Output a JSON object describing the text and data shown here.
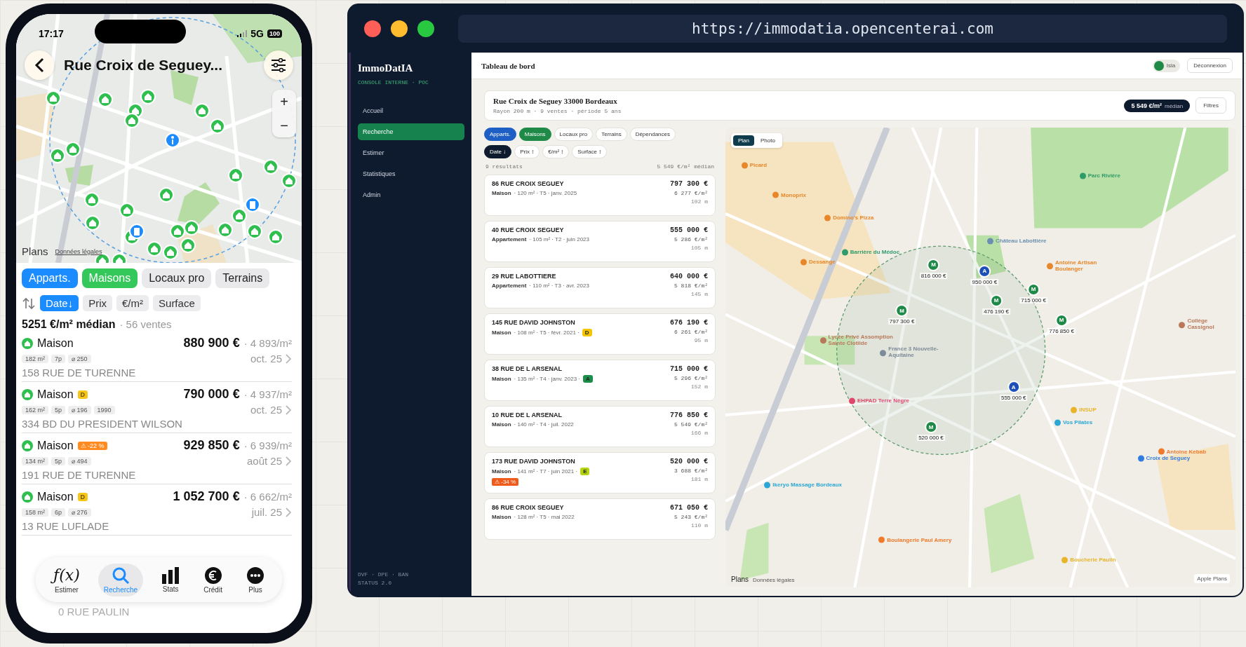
{
  "phone": {
    "status": {
      "time": "17:17",
      "network": "5G",
      "battery": "100"
    },
    "title": "Rue Croix de Seguey...",
    "map": {
      "attribution": "Plans",
      "legal": "Données légales",
      "zoom_in": "+",
      "zoom_out": "−"
    },
    "types": [
      {
        "label": "Apparts.",
        "selected": true,
        "color": "#1a8cff"
      },
      {
        "label": "Maisons",
        "selected": true,
        "color": "#34c759"
      },
      {
        "label": "Locaux pro",
        "selected": false
      },
      {
        "label": "Terrains",
        "selected": false
      }
    ],
    "sorts": [
      {
        "label": "Date↓",
        "selected": true
      },
      {
        "label": "Prix",
        "selected": false
      },
      {
        "label": "€/m²",
        "selected": false
      },
      {
        "label": "Surface",
        "selected": false
      }
    ],
    "median": "5251 €/m² médian",
    "count": "· 56 ventes",
    "listings": [
      {
        "type": "Maison",
        "price": "880 900 €",
        "ppm": "· 4 893/m²",
        "chips": [
          "182 m²",
          "7p",
          "⌀ 250"
        ],
        "date": "oct. 25",
        "address": "158 RUE DE TURENNE"
      },
      {
        "type": "Maison",
        "badge": {
          "kind": "dpe",
          "text": "D",
          "color": "#f5c518"
        },
        "price": "790 000 €",
        "ppm": "· 4 937/m²",
        "chips": [
          "162 m²",
          "5p",
          "⌀ 196",
          "1990"
        ],
        "date": "oct. 25",
        "address": "334 BD DU PRESIDENT WILSON"
      },
      {
        "type": "Maison",
        "badge": {
          "kind": "alert",
          "text": "⚠ -22 %",
          "color": "#ff8a1f"
        },
        "price": "929 850 €",
        "ppm": "· 6 939/m²",
        "chips": [
          "134 m²",
          "5p",
          "⌀ 494"
        ],
        "date": "août 25",
        "address": "191 RUE DE TURENNE"
      },
      {
        "type": "Maison",
        "badge": {
          "kind": "dpe",
          "text": "D",
          "color": "#f5c518"
        },
        "price": "1 052 700 €",
        "ppm": "· 6 662/m²",
        "chips": [
          "158 m²",
          "6p",
          "⌀ 276"
        ],
        "date": "juil. 25",
        "address": "13 RUE LUFLADE"
      }
    ],
    "hidden_address": "0 RUE PAULIN",
    "tabbar": [
      {
        "glyph": "ƒ(x)",
        "label": "Estimer",
        "selected": false
      },
      {
        "label": "Recherche",
        "selected": true
      },
      {
        "label": "Stats",
        "selected": false
      },
      {
        "label": "Crédit",
        "selected": false
      },
      {
        "label": "Plus",
        "selected": false
      }
    ]
  },
  "browser": {
    "url": "https://immodatia.opencenterai.com",
    "sidebar": {
      "logo": "ImmoDatIA",
      "subtitle": "CONSOLE INTERNE · POC",
      "items": [
        {
          "label": "Accueil",
          "selected": false
        },
        {
          "label": "Recherche",
          "selected": true
        },
        {
          "label": "Estimer",
          "selected": false
        },
        {
          "label": "Statistiques",
          "selected": false
        },
        {
          "label": "Admin",
          "selected": false
        }
      ],
      "footer": [
        "DVF · DPE · BAN",
        "STATUS 2.0"
      ]
    },
    "header": {
      "title": "Tableau de bord",
      "user": "Isla",
      "logout": "Déconnexion"
    },
    "search": {
      "address": "Rue Croix de Seguey 33000 Bordeaux",
      "summary": "Rayon 200 m · 9 ventes · période 5 ans",
      "median_value": "5 549 €/m²",
      "median_label": "médian",
      "filters": "Filtres"
    },
    "types": [
      {
        "label": "Apparts.",
        "selected": true,
        "color": "#1d5fc4"
      },
      {
        "label": "Maisons",
        "selected": true,
        "color": "#1f8a47"
      },
      {
        "label": "Locaux pro",
        "selected": false
      },
      {
        "label": "Terrains",
        "selected": false
      },
      {
        "label": "Dépendances",
        "selected": false
      }
    ],
    "sorts": [
      {
        "label": "Date ↓",
        "selected": true
      },
      {
        "label": "Prix ↕",
        "selected": false
      },
      {
        "label": "€/m² ↕",
        "selected": false
      },
      {
        "label": "Surface ↕",
        "selected": false
      }
    ],
    "results": "9 résultats",
    "median": "5 549 €/m² médian",
    "listings": [
      {
        "address": "86 RUE CROIX SEGUEY",
        "type": "Maison",
        "meta": "· 120 m² · T5 · janv. 2025",
        "price": "797 300 €",
        "ppm": "6 277 €/m²",
        "distance": "102 m"
      },
      {
        "address": "40 RUE CROIX SEGUEY",
        "type": "Appartement",
        "meta": "· 105 m² · T2 · juin 2023",
        "price": "555 000 €",
        "ppm": "5 286 €/m²",
        "distance": "105 m"
      },
      {
        "address": "29 RUE LABOTTIERE",
        "type": "Appartement",
        "meta": "· 110 m² · T3 · avr. 2023",
        "price": "640 000 €",
        "ppm": "5 818 €/m²",
        "distance": "145 m"
      },
      {
        "address": "145 RUE DAVID JOHNSTON",
        "type": "Maison",
        "meta": "· 108 m² · T5 · févr. 2021 ·",
        "dpe": {
          "text": "D",
          "color": "#f2c500"
        },
        "price": "676 190 €",
        "ppm": "6 261 €/m²",
        "distance": "95 m"
      },
      {
        "address": "38 RUE DE L ARSENAL",
        "type": "Maison",
        "meta": "· 135 m² · T4 · janv. 2023 ·",
        "dpe": {
          "text": "A",
          "color": "#1a8f4a"
        },
        "price": "715 000 €",
        "ppm": "5 296 €/m²",
        "distance": "152 m"
      },
      {
        "address": "10 RUE DE L ARSENAL",
        "type": "Maison",
        "meta": "· 140 m² · T4 · juil. 2022",
        "price": "776 850 €",
        "ppm": "5 549 €/m²",
        "distance": "166 m"
      },
      {
        "address": "173 RUE DAVID JOHNSTON",
        "type": "Maison",
        "meta": "· 141 m² · T7 · juin 2021 ·",
        "dpe": {
          "text": "E",
          "color": "#b5d30f"
        },
        "alert": "⚠ -34 %",
        "price": "520 000 €",
        "ppm": "3 688 €/m²",
        "distance": "181 m"
      },
      {
        "address": "86 RUE CROIX SEGUEY",
        "type": "Maison",
        "meta": "· 128 m² · T5 · mai 2022",
        "price": "671 050 €",
        "ppm": "5 243 €/m²",
        "distance": "110 m"
      }
    ],
    "map": {
      "modes": [
        {
          "label": "Plan",
          "selected": true
        },
        {
          "label": "Photo",
          "selected": false
        }
      ],
      "markers": [
        {
          "kind": "maison",
          "letter": "M",
          "price": "816 000 €"
        },
        {
          "kind": "appartement",
          "letter": "A",
          "price": "950 000 €"
        },
        {
          "kind": "maison",
          "letter": "M",
          "price": "476 190 €"
        },
        {
          "kind": "maison",
          "letter": "M",
          "price": "715 000 €"
        },
        {
          "kind": "maison",
          "letter": "M",
          "price": "797 300 €"
        },
        {
          "kind": "maison",
          "letter": "M",
          "price": "776 850 €"
        },
        {
          "kind": "appartement",
          "letter": "A",
          "price": "555 000 €"
        },
        {
          "kind": "maison",
          "letter": "M",
          "price": "520 000 €"
        }
      ],
      "pois": [
        {
          "label": "Picard",
          "color": "#e8872a"
        },
        {
          "label": "Monoprix",
          "color": "#e8872a"
        },
        {
          "label": "Domino's Pizza",
          "color": "#e8872a"
        },
        {
          "label": "Dessange",
          "color": "#e8872a"
        },
        {
          "label": "Barrière du Médoc",
          "color": "#2f9a6a"
        },
        {
          "label": "Château Labottière",
          "color": "#6b8fb0"
        },
        {
          "label": "Parc Rivière",
          "color": "#2f9a6a"
        },
        {
          "label": "Antoine Artisan Boulanger",
          "color": "#e8872a"
        },
        {
          "label": "Lycée Privé Assomption Sainte Clotilde",
          "color": "#b9785a"
        },
        {
          "label": "France 3 Nouvelle-Aquitaine",
          "color": "#7d8a99"
        },
        {
          "label": "Collège Cassignol",
          "color": "#b9785a"
        },
        {
          "label": "EHPAD Terre Nègre",
          "color": "#e0456b"
        },
        {
          "label": "INSUP",
          "color": "#e8b42a"
        },
        {
          "label": "Vos Pilates",
          "color": "#2aa7d6"
        },
        {
          "label": "Croix de Seguey",
          "color": "#2f7de0"
        },
        {
          "label": "Antoine Kebab",
          "color": "#f07a2a"
        },
        {
          "label": "Ikeryo Massage Bordeaux",
          "color": "#2aa7d6"
        },
        {
          "label": "Boulangerie Paul Amery",
          "color": "#f07a2a"
        },
        {
          "label": "Boucherie Paulin",
          "color": "#e8b42a"
        }
      ],
      "attribution": "Plans",
      "legal": "Données légales",
      "credit": "Apple Plans"
    }
  }
}
